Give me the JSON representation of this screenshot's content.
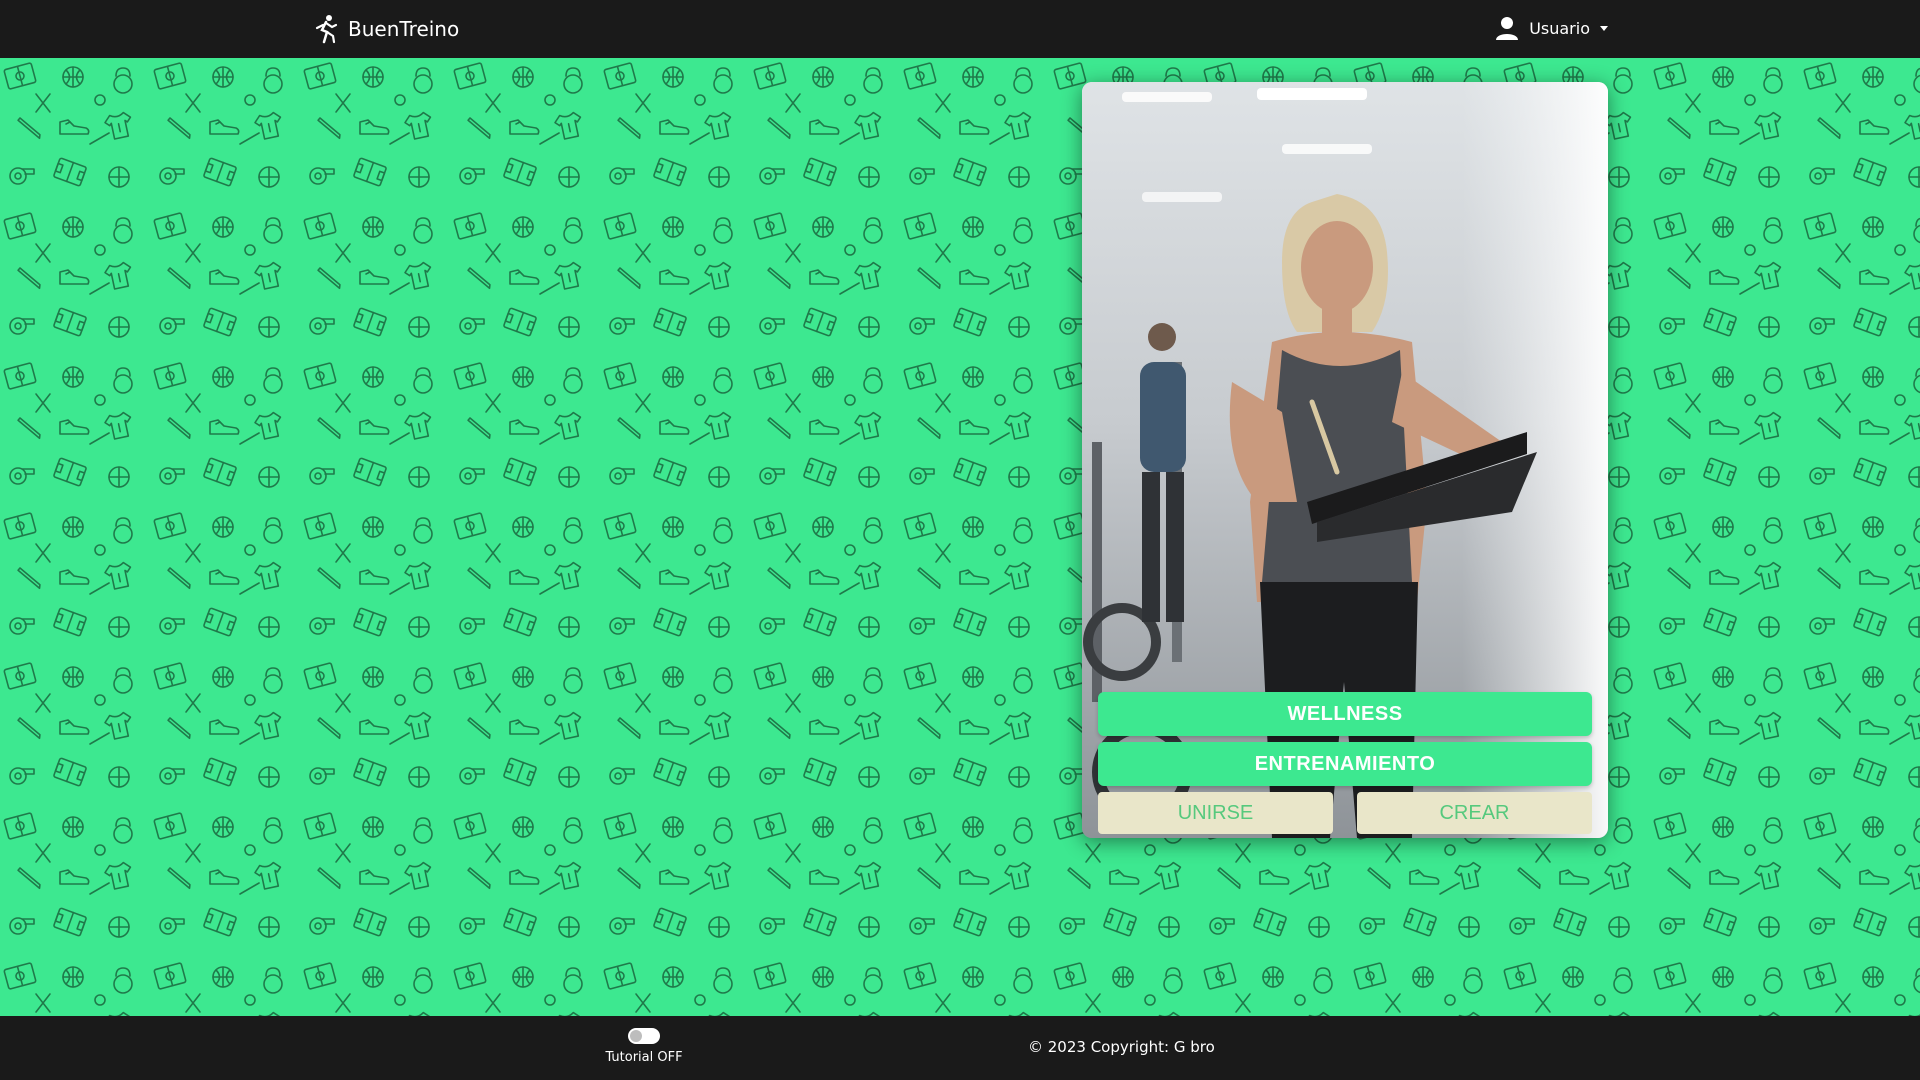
{
  "navbar": {
    "brand": "BuenTreino",
    "brand_icon": "running-person-icon",
    "user_label": "Usuario",
    "user_icon": "user-icon"
  },
  "background": {
    "color": "#3de890",
    "pattern_icons": [
      "soccer-field-icon",
      "basketball-icon",
      "kettlebell-icon",
      "sneaker-icon",
      "baseball-bat-icon",
      "jersey-icon",
      "whistle-icon"
    ]
  },
  "card": {
    "image_alt": "Trainer with clipboard in gym",
    "buttons": {
      "wellness": "WELLNESS",
      "entrenamiento": "ENTRENAMIENTO",
      "unirse": "UNIRSE",
      "crear": "CREAR"
    }
  },
  "footer": {
    "tutorial_label": "Tutorial OFF",
    "tutorial_on": false,
    "copyright": "© 2023 Copyright: G bro"
  },
  "colors": {
    "accent": "#3de890",
    "dark": "#1a1a1a",
    "beige": "#e9e6c9"
  }
}
